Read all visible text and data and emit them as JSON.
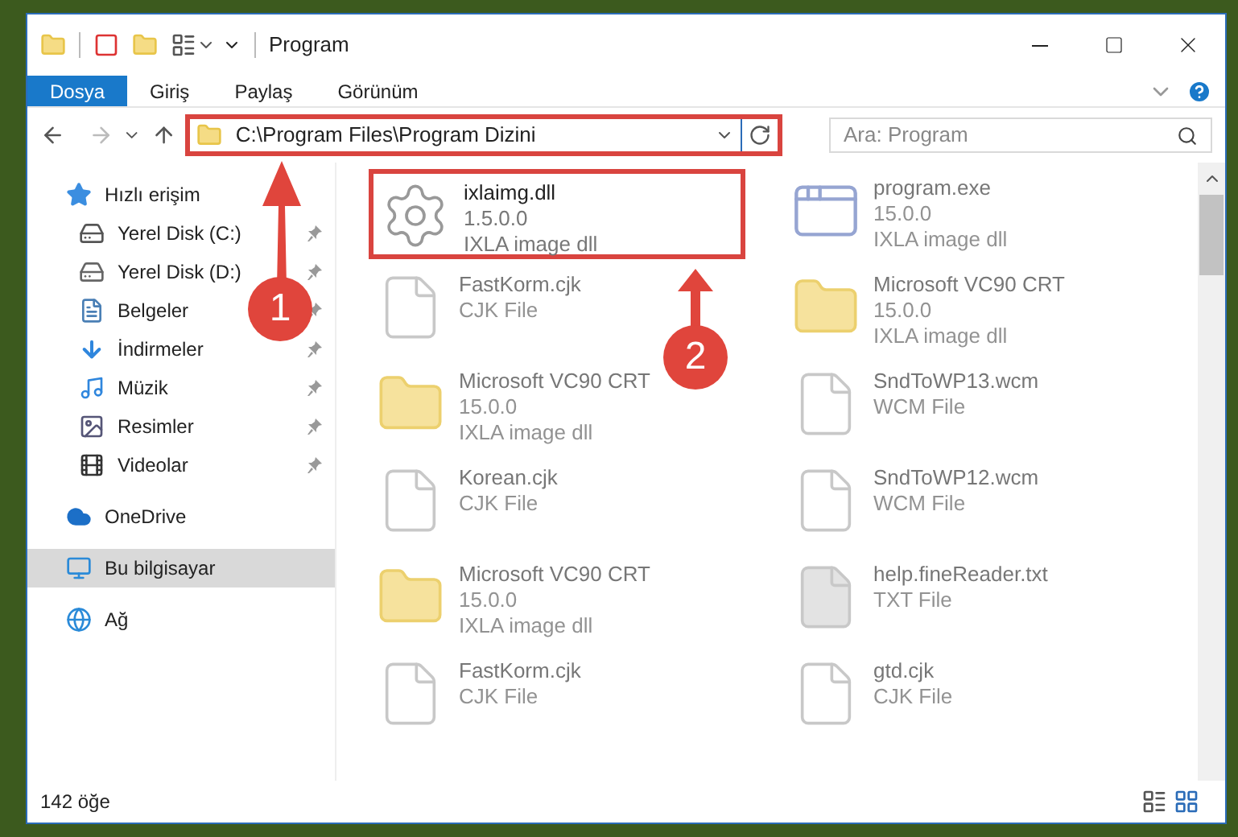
{
  "window": {
    "title": "Program"
  },
  "ribbon_tabs": [
    {
      "label": "Dosya",
      "selected": true
    },
    {
      "label": "Giriş",
      "selected": false
    },
    {
      "label": "Paylaş",
      "selected": false
    },
    {
      "label": "Görünüm",
      "selected": false
    }
  ],
  "address_bar": {
    "path": "C:\\Program Files\\Program Dizini",
    "highlighted": true
  },
  "search": {
    "placeholder": "Ara: Program"
  },
  "sidebar": {
    "items": [
      {
        "label": "Hızlı erişim",
        "kind": "star",
        "selected": false,
        "children": [
          {
            "label": "Yerel Disk (C:)",
            "kind": "drive-c",
            "pinned": true
          },
          {
            "label": "Yerel Disk (D:)",
            "kind": "drive",
            "pinned": true
          },
          {
            "label": "Belgeler",
            "kind": "documents",
            "pinned": true
          },
          {
            "label": "İndirmeler",
            "kind": "downloads",
            "pinned": true
          },
          {
            "label": "Müzik",
            "kind": "music",
            "pinned": true
          },
          {
            "label": "Resimler",
            "kind": "pictures",
            "pinned": true
          },
          {
            "label": "Videolar",
            "kind": "videos",
            "pinned": true
          }
        ]
      },
      {
        "label": "OneDrive",
        "kind": "cloud",
        "selected": false
      },
      {
        "label": "Bu bilgisayar",
        "kind": "computer",
        "selected": true
      },
      {
        "label": "Ağ",
        "kind": "network",
        "selected": false
      }
    ]
  },
  "files": [
    {
      "name": "ixlaimg.dll",
      "details": [
        "1.5.0.0",
        "IXLA image dll"
      ],
      "kind": "dll",
      "highlighted": true,
      "blurred": false
    },
    {
      "name": "program.exe",
      "details": [
        "15.0.0",
        "IXLA image dll"
      ],
      "kind": "exe",
      "highlighted": false,
      "blurred": true
    },
    {
      "name": "FastKorm.cjk",
      "details": [
        "CJK File"
      ],
      "kind": "file",
      "highlighted": false,
      "blurred": true
    },
    {
      "name": "Microsoft VC90 CRT",
      "details": [
        "15.0.0",
        "IXLA image dll"
      ],
      "kind": "folder",
      "highlighted": false,
      "blurred": true
    },
    {
      "name": "Microsoft VC90 CRT",
      "details": [
        "15.0.0",
        "IXLA image dll"
      ],
      "kind": "folder",
      "highlighted": false,
      "blurred": true
    },
    {
      "name": "SndToWP13.wcm",
      "details": [
        "WCM File"
      ],
      "kind": "file",
      "highlighted": false,
      "blurred": true
    },
    {
      "name": "Korean.cjk",
      "details": [
        "CJK File"
      ],
      "kind": "file",
      "highlighted": false,
      "blurred": true
    },
    {
      "name": "SndToWP12.wcm",
      "details": [
        "WCM File"
      ],
      "kind": "file",
      "highlighted": false,
      "blurred": true
    },
    {
      "name": "Microsoft VC90 CRT",
      "details": [
        "15.0.0",
        "IXLA image dll"
      ],
      "kind": "folder",
      "highlighted": false,
      "blurred": true
    },
    {
      "name": "help.fineReader.txt",
      "details": [
        "TXT File"
      ],
      "kind": "grayfile",
      "highlighted": false,
      "blurred": true
    },
    {
      "name": "FastKorm.cjk",
      "details": [
        "CJK File"
      ],
      "kind": "file",
      "highlighted": false,
      "blurred": true
    },
    {
      "name": "gtd.cjk",
      "details": [
        "CJK File"
      ],
      "kind": "file",
      "highlighted": false,
      "blurred": true
    }
  ],
  "status_bar": {
    "item_count": "142 öğe"
  },
  "annotations": [
    {
      "number": "1"
    },
    {
      "number": "2"
    }
  ]
}
